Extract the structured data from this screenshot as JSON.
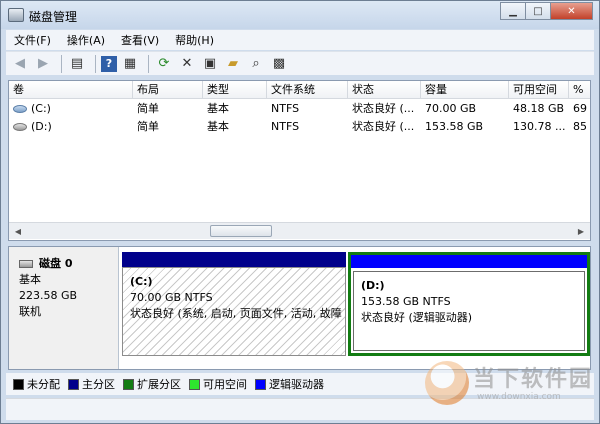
{
  "window": {
    "title": "磁盘管理",
    "controls": [
      "minimize",
      "maximize",
      "close"
    ]
  },
  "menu": [
    "文件(F)",
    "操作(A)",
    "查看(V)",
    "帮助(H)"
  ],
  "toolbar_icons": [
    "back-arrow-icon",
    "forward-arrow-icon",
    "console-tree-icon",
    "help-icon",
    "properties-pane-icon",
    "refresh-icon",
    "delete-icon",
    "properties-icon",
    "open-folder-icon",
    "search-icon",
    "export-icon"
  ],
  "volume_list": {
    "columns": [
      "卷",
      "布局",
      "类型",
      "文件系统",
      "状态",
      "容量",
      "可用空间",
      "%"
    ],
    "rows": [
      {
        "volume": "(C:)",
        "icon": "system-volume-icon",
        "layout": "简单",
        "type": "基本",
        "fs": "NTFS",
        "status": "状态良好 (...",
        "capacity": "70.00 GB",
        "free": "48.18 GB",
        "pct": "69"
      },
      {
        "volume": "(D:)",
        "icon": "data-volume-icon",
        "layout": "简单",
        "type": "基本",
        "fs": "NTFS",
        "status": "状态良好 (...",
        "capacity": "153.58 GB",
        "free": "130.78 ...",
        "pct": "85"
      }
    ]
  },
  "disk": {
    "name": "磁盘 0",
    "type": "基本",
    "size": "223.58 GB",
    "state": "联机",
    "partitions": [
      {
        "label": "(C:)",
        "size_fs": "70.00 GB NTFS",
        "status": "状态良好 (系统, 启动, 页面文件, 活动, 故障"
      },
      {
        "label": "(D:)",
        "size_fs": "153.58 GB NTFS",
        "status": "状态良好 (逻辑驱动器)"
      }
    ]
  },
  "legend": [
    {
      "label": "未分配",
      "color": "#000000"
    },
    {
      "label": "主分区",
      "color": "#00008b"
    },
    {
      "label": "扩展分区",
      "color": "#137c13"
    },
    {
      "label": "可用空间",
      "color": "#2ee62e"
    },
    {
      "label": "逻辑驱动器",
      "color": "#0000ff"
    }
  ],
  "watermark": {
    "text": "当下软件园",
    "url": "www.downxia.com"
  }
}
